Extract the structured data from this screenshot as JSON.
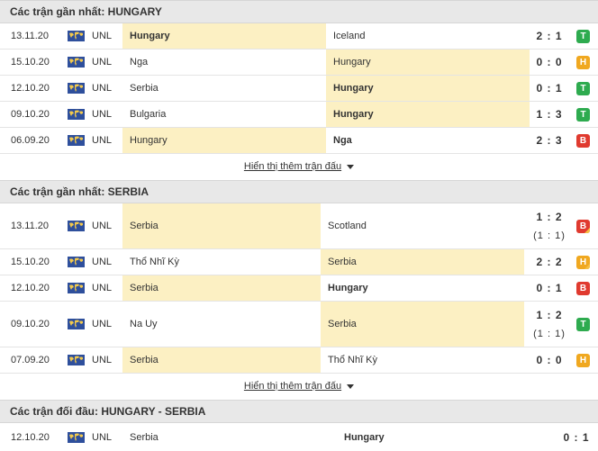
{
  "colors": {
    "win": "#2eab4f",
    "draw": "#f0a820",
    "loss": "#e03a2f",
    "highlight": "#fcf0c3"
  },
  "section1": {
    "title": "Các trận gần nhất: HUNGARY",
    "rows": [
      {
        "date": "13.11.20",
        "league": "UNL",
        "home": "Hungary",
        "away": "Iceland",
        "score": "2 : 1",
        "result": "T"
      },
      {
        "date": "15.10.20",
        "league": "UNL",
        "home": "Nga",
        "away": "Hungary",
        "score": "0 : 0",
        "result": "H"
      },
      {
        "date": "12.10.20",
        "league": "UNL",
        "home": "Serbia",
        "away": "Hungary",
        "score": "0 : 1",
        "result": "T"
      },
      {
        "date": "09.10.20",
        "league": "UNL",
        "home": "Bulgaria",
        "away": "Hungary",
        "score": "1 : 3",
        "result": "T"
      },
      {
        "date": "06.09.20",
        "league": "UNL",
        "home": "Hungary",
        "away": "Nga",
        "score": "2 : 3",
        "result": "B"
      }
    ],
    "more": "Hiển thị thêm trận đấu"
  },
  "section2": {
    "title": "Các trận gần nhất: SERBIA",
    "rows": [
      {
        "date": "13.11.20",
        "league": "UNL",
        "home": "Serbia",
        "away": "Scotland",
        "score": "1 : 2",
        "ht": "(1 : 1)",
        "result": "B"
      },
      {
        "date": "15.10.20",
        "league": "UNL",
        "home": "Thổ Nhĩ Kỳ",
        "away": "Serbia",
        "score": "2 : 2",
        "result": "H"
      },
      {
        "date": "12.10.20",
        "league": "UNL",
        "home": "Serbia",
        "away": "Hungary",
        "score": "0 : 1",
        "result": "B"
      },
      {
        "date": "09.10.20",
        "league": "UNL",
        "home": "Na Uy",
        "away": "Serbia",
        "score": "1 : 2",
        "ht": "(1 : 1)",
        "result": "T"
      },
      {
        "date": "07.09.20",
        "league": "UNL",
        "home": "Serbia",
        "away": "Thổ Nhĩ Kỳ",
        "score": "0 : 0",
        "result": "H"
      }
    ],
    "more": "Hiển thị thêm trận đấu"
  },
  "section3": {
    "title": "Các trận đối đầu: HUNGARY - SERBIA",
    "rows": [
      {
        "date": "12.10.20",
        "league": "UNL",
        "home": "Serbia",
        "away": "Hungary",
        "score": "0 : 1"
      }
    ]
  }
}
